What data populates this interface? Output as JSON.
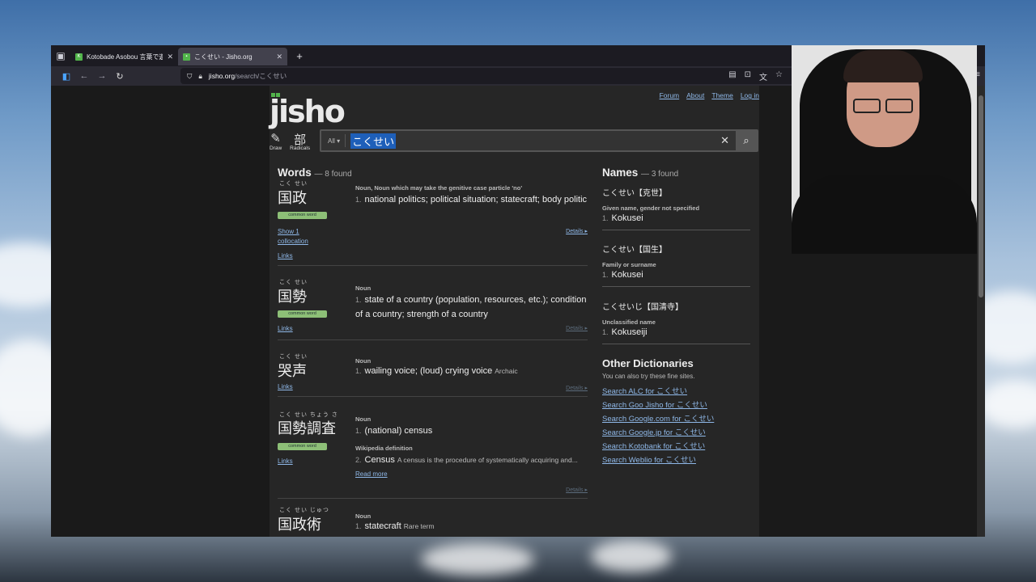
{
  "browser": {
    "tabs": [
      {
        "title": "Kotobade Asobou 言葉で遊ぼ",
        "active": false
      },
      {
        "title": "こくせい - Jisho.org",
        "active": true
      }
    ],
    "url_host": "jisho.org",
    "url_path": "/search/こくせい"
  },
  "site": {
    "logo": "jisho",
    "top_links": [
      "Forum",
      "About",
      "Theme",
      "Log in"
    ],
    "tools": [
      {
        "glyph": "✎",
        "label": "Draw"
      },
      {
        "glyph": "部",
        "label": "Radicals"
      }
    ],
    "search_filter": "All ▾",
    "query": "こくせい"
  },
  "words": {
    "heading": "Words",
    "count": "— 8 found",
    "entries": [
      {
        "furigana": "こく せい",
        "kanji": "国政",
        "common": "common word",
        "links": [
          "Show 1",
          "collocation",
          "Links"
        ],
        "pos": "Noun, Noun which may take the genitive case particle 'no'",
        "def_num": "1.",
        "def": "national politics; political situation; statecraft; body politic",
        "details": "Details ▸"
      },
      {
        "furigana": "こく せい",
        "kanji": "国勢",
        "common": "common word",
        "links": [
          "Links"
        ],
        "pos": "Noun",
        "def_num": "1.",
        "def": "state of a country (population, resources, etc.); condition of a country; strength of a country",
        "details": "Details ▸"
      },
      {
        "furigana": "こく せい",
        "kanji": "哭声",
        "links": [
          "Links"
        ],
        "pos": "Noun",
        "def_num": "1.",
        "def": "wailing voice; (loud) crying voice",
        "note": "Archaic",
        "details": "Details ▸"
      },
      {
        "furigana": "こく せい ちょう さ",
        "kanji": "国勢調査",
        "common": "common word",
        "links": [
          "Links"
        ],
        "pos": "Noun",
        "def_num": "1.",
        "def": "(national) census",
        "pos2": "Wikipedia definition",
        "def2_num": "2.",
        "def2": "Census",
        "def2_note": "A census is the procedure of systematically acquiring and...",
        "read_more": "Read more",
        "details": "Details ▸"
      },
      {
        "furigana": "こく せい じゅつ",
        "kanji": "国政術",
        "pos": "Noun",
        "def_num": "1.",
        "def": "statecraft",
        "note": "Rare term"
      }
    ]
  },
  "names": {
    "heading": "Names",
    "count": "— 3 found",
    "entries": [
      {
        "head": "こくせい【克世】",
        "type": "Given name, gender not specified",
        "num": "1.",
        "val": "Kokusei"
      },
      {
        "head": "こくせい【国生】",
        "type": "Family or surname",
        "num": "1.",
        "val": "Kokusei"
      },
      {
        "head": "こくせいじ【国清寺】",
        "type": "Unclassified name",
        "num": "1.",
        "val": "Kokuseiji"
      }
    ]
  },
  "other_dictionaries": {
    "heading": "Other Dictionaries",
    "subtitle": "You can also try these fine sites.",
    "links": [
      "Search ALC for こくせい",
      "Search Goo Jisho for こくせい",
      "Search Google.com for こくせい",
      "Search Google.jp for こくせい",
      "Search Kotobank for こくせい",
      "Search Weblio for こくせい"
    ]
  },
  "colors": {
    "accent_green": "#52b54b",
    "link_blue": "#8fb8e8",
    "selection_blue": "#1e5fb9"
  }
}
